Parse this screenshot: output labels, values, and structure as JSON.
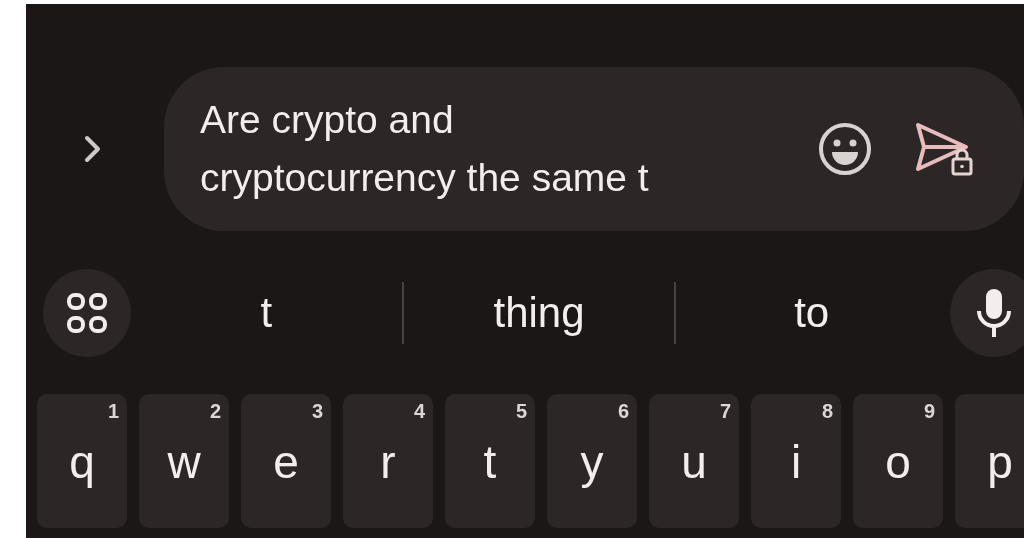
{
  "compose": {
    "lines": [
      "Are crypto and",
      "cryptocurrency the same t"
    ]
  },
  "suggestions": [
    "t",
    "thing",
    "to"
  ],
  "keys": [
    {
      "letter": "q",
      "number": "1"
    },
    {
      "letter": "w",
      "number": "2"
    },
    {
      "letter": "e",
      "number": "3"
    },
    {
      "letter": "r",
      "number": "4"
    },
    {
      "letter": "t",
      "number": "5"
    },
    {
      "letter": "y",
      "number": "6"
    },
    {
      "letter": "u",
      "number": "7"
    },
    {
      "letter": "i",
      "number": "8"
    },
    {
      "letter": "o",
      "number": "9"
    },
    {
      "letter": "p"
    }
  ]
}
